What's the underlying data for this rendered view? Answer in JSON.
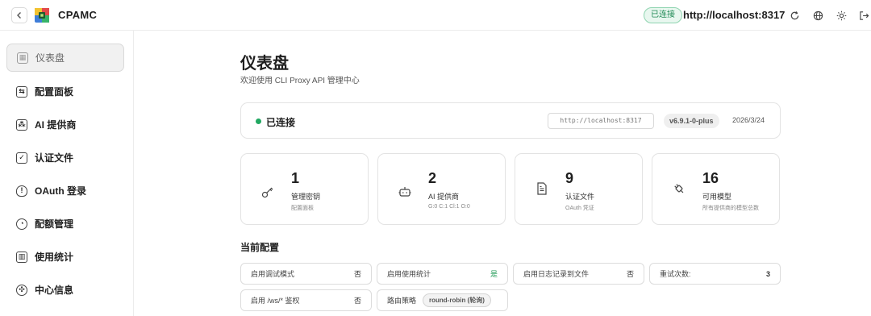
{
  "header": {
    "brand": "CPAMC",
    "connection_badge": "已连接",
    "server_url": "http://localhost:8317"
  },
  "sidebar": {
    "items": [
      {
        "label": "仪表盘",
        "icon": "dashboard-icon"
      },
      {
        "label": "配置面板",
        "icon": "sliders-icon"
      },
      {
        "label": "AI 提供商",
        "icon": "network-icon"
      },
      {
        "label": "认证文件",
        "icon": "file-check-icon"
      },
      {
        "label": "OAuth 登录",
        "icon": "shield-icon"
      },
      {
        "label": "配额管理",
        "icon": "pie-chart-icon"
      },
      {
        "label": "使用统计",
        "icon": "bar-chart-icon"
      },
      {
        "label": "中心信息",
        "icon": "info-icon"
      }
    ]
  },
  "main": {
    "title": "仪表盘",
    "subtitle": "欢迎使用 CLI Proxy API 管理中心",
    "status": {
      "text": "已连接",
      "url": "http://localhost:8317",
      "version": "v6.9.1-0-plus",
      "date": "2026/3/24"
    },
    "stats": [
      {
        "value": "1",
        "label": "管理密钥",
        "sub": "配置面板",
        "icon": "key-icon"
      },
      {
        "value": "2",
        "label": "AI 提供商",
        "sub": "G:0 C:1 Cl:1 O:0",
        "icon": "bot-icon"
      },
      {
        "value": "9",
        "label": "认证文件",
        "sub": "OAuth 凭证",
        "icon": "document-icon"
      },
      {
        "value": "16",
        "label": "可用模型",
        "sub": "所有提供商的模型总数",
        "icon": "plug-icon"
      }
    ],
    "config_section_title": "当前配置",
    "config": {
      "debug": {
        "label": "启用调试模式",
        "value": "否"
      },
      "usage_stats": {
        "label": "启用使用统计",
        "value": "是"
      },
      "log_to_file": {
        "label": "启用日志记录到文件",
        "value": "否"
      },
      "retry": {
        "label": "重试次数:",
        "value": "3"
      },
      "ws_auth": {
        "label": "启用 /ws/* 鉴权",
        "value": "否"
      },
      "routing": {
        "label": "路由策略",
        "value": "round-robin (轮询)"
      }
    }
  },
  "colors": {
    "connected_green": "#22a862",
    "badge_bg": "#e8f7ef"
  }
}
